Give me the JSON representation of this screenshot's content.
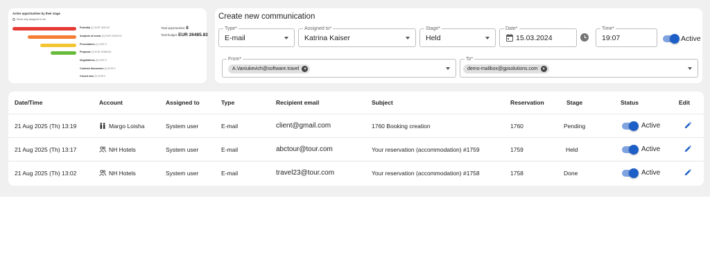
{
  "colors": {
    "accent": "#1e5fc7",
    "accent_light": "#7fa2e0",
    "funnel_red": "#e53935",
    "funnel_orange": "#f57c33",
    "funnel_yellow": "#f2c531",
    "funnel_green": "#66bb3a"
  },
  "funnel": {
    "title": "Active opportunities by their stage",
    "checkbox_label": "Show only assigned to me",
    "total_opportunities_label": "Total opportunities:",
    "total_opportunities_value": "8",
    "total_budget_label": "Total budget:",
    "total_budget_value": "EUR 26485.83",
    "stages": [
      {
        "name": "Potential",
        "count": "(2)",
        "amount": "EUR 1000.00",
        "color": "#e53935"
      },
      {
        "name": "Analysis of needs",
        "count": "(2)",
        "amount": "EUR 10000.00",
        "color": "#f57c33"
      },
      {
        "name": "Presentation",
        "count": "(1)",
        "amount": "EUR 0",
        "color": "#f2c531"
      },
      {
        "name": "Proposal",
        "count": "(2)",
        "amount": "EUR 15485.83",
        "color": "#66bb3a"
      },
      {
        "name": "Negotiations",
        "count": "(0)",
        "amount": "EUR 0",
        "color": ""
      },
      {
        "name": "Contract discussion",
        "count": "(0)",
        "amount": "EUR 0",
        "color": ""
      },
      {
        "name": "Closed won",
        "count": "(0)",
        "amount": "EUR 0",
        "color": ""
      }
    ]
  },
  "create": {
    "title": "Create new communication",
    "type": {
      "label": "Type*",
      "value": "E-mail"
    },
    "assigned": {
      "label": "Assigned to*",
      "value": "Katrina Kaiser"
    },
    "stage": {
      "label": "Stage*",
      "value": "Held"
    },
    "date": {
      "label": "Date*",
      "value": "15.03.2024",
      "icon": "calendar-icon"
    },
    "time": {
      "label": "Time*",
      "value": "19:07",
      "icon": "clock-icon"
    },
    "active_label": "Active",
    "from": {
      "label": "From*",
      "chip": "A.Vaniukevich@software.travel"
    },
    "to": {
      "label": "To*",
      "chip": "demo-mailbox@gpsolutions.com"
    }
  },
  "table": {
    "headers": [
      "Date/Time",
      "Account",
      "Assigned to",
      "Type",
      "Recipient email",
      "Subject",
      "Reservation",
      "Stage",
      "Status",
      "Edit"
    ],
    "rows": [
      {
        "datetime": "21 Aug 2025 (Th) 13:19",
        "account_icon": "person-pair-icon",
        "account": "Margo Loisha",
        "assigned": "System user",
        "type": "E-mail",
        "email": "client@gmail.com",
        "subject": "1760 Booking creation",
        "reservation": "1760",
        "stage": "Pending",
        "status": "Active"
      },
      {
        "datetime": "21 Aug 2025 (Th) 13:17",
        "account_icon": "group-icon",
        "account": "NH Hotels",
        "assigned": "System user",
        "type": "E-mail",
        "email": "abctour@tour.com",
        "subject": "Your reservation (accommodation) #1759",
        "reservation": "1759",
        "stage": "Held",
        "status": "Active"
      },
      {
        "datetime": "21 Aug 2025 (Th) 13:02",
        "account_icon": "group-icon",
        "account": "NH Hotels",
        "assigned": "System user",
        "type": "E-mail",
        "email": "travel23@tour.com",
        "subject": "Your reservation (accommodation) #1758",
        "reservation": "1758",
        "stage": "Done",
        "status": "Active"
      }
    ]
  }
}
